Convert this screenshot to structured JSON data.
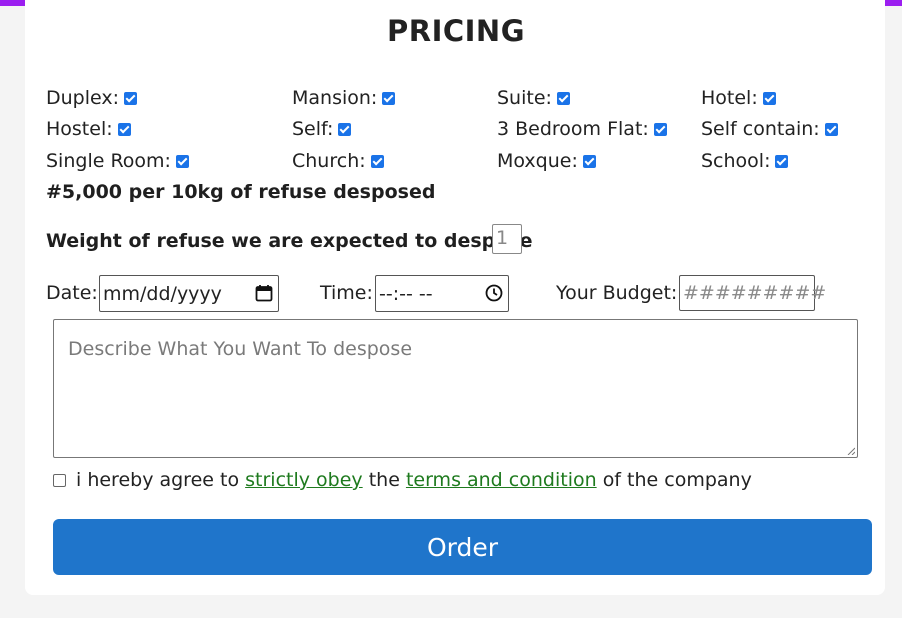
{
  "title": "PRICING",
  "options": [
    {
      "label": "Duplex:",
      "checked": true
    },
    {
      "label": "Mansion:",
      "checked": true
    },
    {
      "label": "Suite:",
      "checked": true
    },
    {
      "label": "Hotel:",
      "checked": true
    },
    {
      "label": "Hostel:",
      "checked": true
    },
    {
      "label": "Self:",
      "checked": true
    },
    {
      "label": "3 Bedroom Flat:",
      "checked": true
    },
    {
      "label": "Self contain:",
      "checked": true
    },
    {
      "label": "Single Room:",
      "checked": true
    },
    {
      "label": "Church:",
      "checked": true
    },
    {
      "label": "Moxque:",
      "checked": true
    },
    {
      "label": "School:",
      "checked": true
    }
  ],
  "price_text": "#5,000 per 10kg of refuse desposed",
  "weight": {
    "label": "Weight of refuse we are expected to despose",
    "placeholder": "1"
  },
  "date": {
    "label": "Date:",
    "placeholder": "mm/dd/yyyy"
  },
  "time": {
    "label": "Time:",
    "placeholder": "--:-- --"
  },
  "budget": {
    "label": "Your Budget:",
    "placeholder": "#########"
  },
  "description": {
    "placeholder": "Describe What You Want To despose"
  },
  "agreement": {
    "prefix": "i hereby agree to",
    "link1": "strictly obey",
    "middle": "the",
    "link2": "terms and condition",
    "suffix": "of the company"
  },
  "order_label": "Order",
  "colors": {
    "topbar": "#9b1ef0",
    "checkbox": "#1a73e8",
    "link": "#1e7a1e",
    "button": "#1f75cb"
  }
}
